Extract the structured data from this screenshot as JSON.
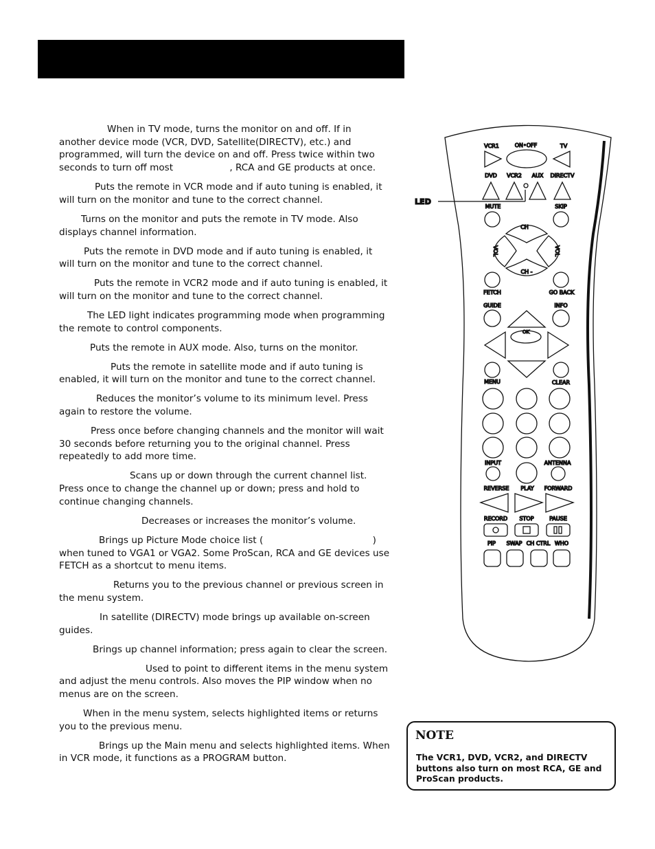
{
  "paragraphs": [
    {
      "indent": 70,
      "text": "When in TV mode, turns the monitor on and off. If in another device mode (VCR, DVD, Satellite(DIRECTV), etc.) and programmed, will turn the device on and off. Press twice within two seconds to turn off most",
      "gap": 78,
      "text2": ", RCA and GE products at once."
    },
    {
      "indent": 52,
      "text": "Puts the remote in VCR mode and if auto tuning is enabled, it will turn on the monitor and tune to the correct channel."
    },
    {
      "indent": 32,
      "text": "Turns on the monitor and puts the remote in TV mode. Also displays channel information."
    },
    {
      "indent": 36,
      "text": "Puts the remote in DVD mode and if auto tuning is enabled, it will turn on the monitor and tune to the correct channel."
    },
    {
      "indent": 51,
      "text": "Puts the remote in VCR2 mode and if auto tuning is enabled, it will turn on the monitor and tune to the correct channel."
    },
    {
      "indent": 41,
      "text": "The LED light indicates programming mode when programming the remote to control components."
    },
    {
      "indent": 45,
      "text": "Puts the remote in AUX mode. Also, turns on the monitor."
    },
    {
      "indent": 75,
      "text": "Puts the remote in satellite mode and if auto tuning is enabled, it will turn on the monitor and tune to the correct channel."
    },
    {
      "indent": 54,
      "text": "Reduces the monitor’s volume to its minimum level. Press again to restore the volume."
    },
    {
      "indent": 46,
      "text": "Press once before changing channels and the monitor will wait 30 seconds before returning you to the original channel. Press repeatedly to add more time."
    },
    {
      "indent": 103,
      "text": "Scans up or down through the current channel list. Press once to change the channel up or down; press and hold to continue changing channels."
    },
    {
      "indent": 120,
      "text": "Decreases or increases the monitor’s volume."
    },
    {
      "indent": 58,
      "text": "Brings up Picture Mode choice list (",
      "gap": 155,
      "text2": ") when tuned to VGA1 or VGA2. Some ProScan, RCA and GE devices use FETCH as a shortcut to menu items."
    },
    {
      "indent": 79,
      "text": "Returns you to the previous channel or previous screen in the menu system."
    },
    {
      "indent": 59,
      "text": "In satellite (DIRECTV) mode brings up available on-screen guides."
    },
    {
      "indent": 49,
      "text": "Brings up channel information; press again to clear the screen."
    },
    {
      "indent": 126,
      "text": "Used to point to different items in the menu system and adjust the menu controls. Also moves the PIP window when no menus are on the screen."
    },
    {
      "indent": 35,
      "text": "When in the menu system, selects highlighted items or returns you to the previous menu."
    },
    {
      "indent": 58,
      "text": "Brings up the Main menu and selects highlighted items. When in VCR mode, it functions as a PROGRAM button."
    }
  ],
  "remote": {
    "led_callout": "LED",
    "vcr1": "VCR1",
    "on_off": "ON•OFF",
    "tv": "TV",
    "dvd": "DVD",
    "vcr2": "VCR2",
    "aux": "AUX",
    "directv": "DIRECTV",
    "mute": "MUTE",
    "skip": "SKIP",
    "ch": "CH",
    "ch_minus": "CH -",
    "vol": "VOL",
    "fetch": "FETCH",
    "go_back": "GO  BACK",
    "guide": "GUIDE",
    "info": "INFO",
    "ok": "OK",
    "menu": "MENU",
    "clear": "CLEAR",
    "input": "INPUT",
    "antenna": "ANTENNA",
    "reverse": "REVERSE",
    "play": "PLAY",
    "forward": "FORWARD",
    "record": "RECORD",
    "stop": "STOP",
    "pause": "PAUSE",
    "pip": "PIP",
    "swap": "SWAP",
    "ch_ctrl": "CH CTRL",
    "who": "WHO"
  },
  "note": {
    "title": "NOTE",
    "text": "The VCR1, DVD, VCR2, and DIRECTV buttons also turn on most RCA, GE and ProScan products."
  }
}
